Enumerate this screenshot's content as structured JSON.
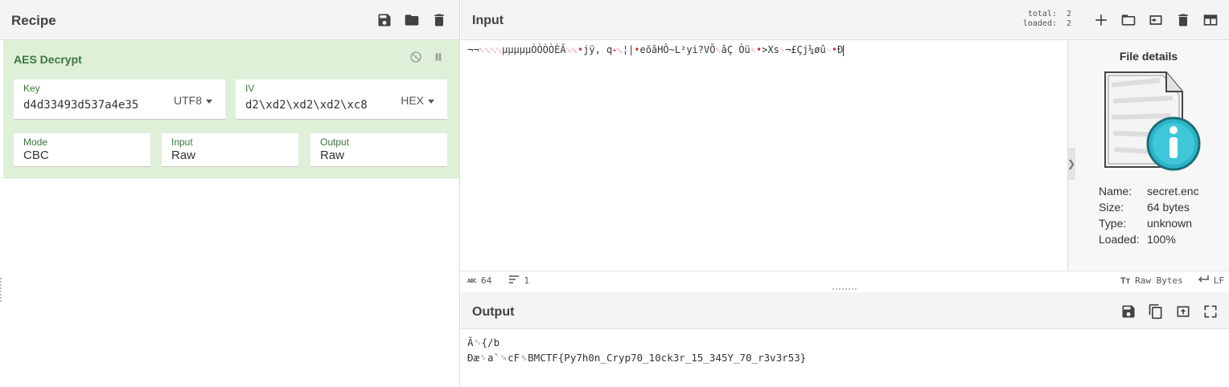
{
  "recipe": {
    "title": "Recipe",
    "icons": [
      "save-icon",
      "folder-icon",
      "trash-icon"
    ],
    "operation": {
      "title": "AES Decrypt",
      "key": {
        "label": "Key",
        "value": "d4d33493d537a4e35",
        "encoding": "UTF8"
      },
      "iv": {
        "label": "IV",
        "value": "d2\\xd2\\xd2\\xd2\\xc8",
        "encoding": "HEX"
      },
      "mode": {
        "label": "Mode",
        "value": "CBC"
      },
      "input": {
        "label": "Input",
        "value": "Raw"
      },
      "output": {
        "label": "Output",
        "value": "Raw"
      }
    }
  },
  "input": {
    "title": "Input",
    "stats": {
      "total_label": "total:",
      "total": "2",
      "loaded_label": "loaded:",
      "loaded": "2"
    },
    "text_parts": [
      "¬¬",
      "␀␁␂␃",
      "µµµµµÒÒÒÒÈÃ",
      "␄␅",
      "•",
      "jÿ, q",
      "•␆",
      "¦|",
      "•",
      "eõâHÔ~L²yi?VÕ",
      "␇",
      "âÇ Òü",
      "␈",
      "•",
      ">Xs",
      "␉",
      "¬£Çj¼øû",
      "␊",
      "•",
      "Ð"
    ],
    "file_details": {
      "title": "File details",
      "name_label": "Name:",
      "name": "secret.enc",
      "size_label": "Size:",
      "size": "64 bytes",
      "type_label": "Type:",
      "type": "unknown",
      "loaded_label": "Loaded:",
      "loaded": "100%"
    },
    "status": {
      "length": "64",
      "lines": "1",
      "charset": "Raw Bytes",
      "eol": "LF"
    }
  },
  "output": {
    "title": "Output",
    "line1": "Ã␋{/b",
    "line2": "Ðæ␌a`␍cF␎BMCTF{Py7h0n_Cryp70_10ck3r_15_345Y_70_r3v3r53}"
  },
  "colors": {
    "operation_bg": "#dff0d8",
    "operation_label": "#3c763d",
    "control_char": "#d4353a",
    "icon": "#424242"
  }
}
